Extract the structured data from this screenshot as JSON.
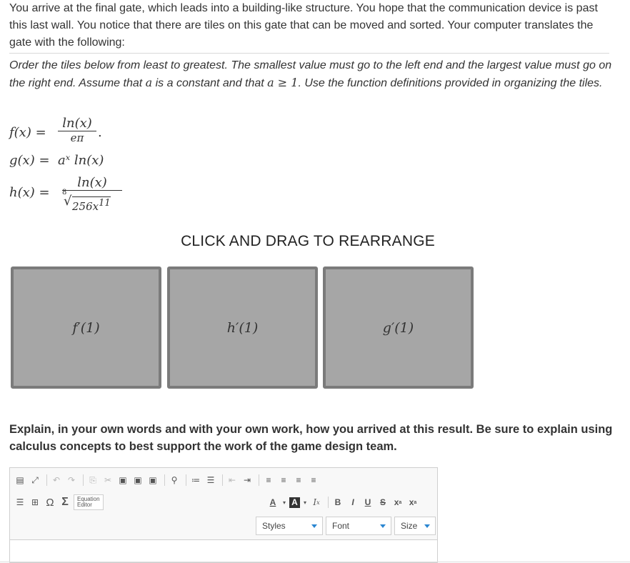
{
  "intro_text": "You arrive at the final gate, which leads into a building-like structure. You hope that the communication device is past this last wall. You notice that there are tiles on this gate that can be moved and sorted. Your computer translates the gate with the following:",
  "instructions": {
    "part1": "Order the tiles below from least to greatest. The smallest value must go to the left end and the largest value must go on the right end. Assume that ",
    "a": "a",
    "part2": " is a constant and that ",
    "cond": "a ≥ 1",
    "part3": ". Use the function definitions provided in organizing the tiles."
  },
  "functions": {
    "f": {
      "lhs": "f(x) =",
      "num": "ln(x)",
      "den": "eπ",
      "trail": "."
    },
    "g": {
      "lhs": "g(x) =",
      "rhs": "aˣ ln(x)"
    },
    "h": {
      "lhs": "h(x) =",
      "num": "ln(x)",
      "root_index": "8",
      "radicand": "256x",
      "exponent": "11"
    }
  },
  "drag_title": "CLICK AND DRAG TO REARRANGE",
  "tiles": [
    {
      "label": "f′(1)"
    },
    {
      "label": "h′(1)"
    },
    {
      "label": "g′(1)"
    }
  ],
  "explain_text": "Explain, in your own words and with your own work, how you arrived at this result. Be sure to explain using calculus concepts to best support the work of the game design team.",
  "editor": {
    "equation_editor_line1": "Equation",
    "equation_editor_line2": "Editor",
    "styles_label": "Styles",
    "font_label": "Font",
    "size_label": "Size",
    "bold": "B",
    "italic": "I",
    "underline": "U",
    "strike": "S",
    "omega": "Ω",
    "sigma": "Σ"
  }
}
